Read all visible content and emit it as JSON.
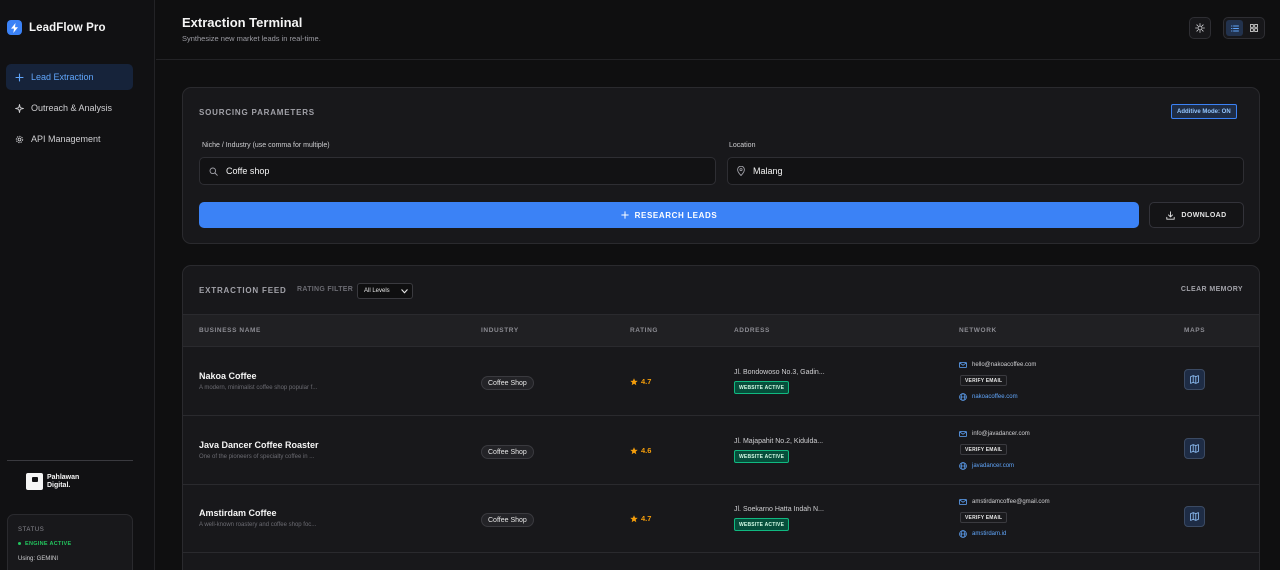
{
  "app": {
    "name": "LeadFlow Pro"
  },
  "sidebar": {
    "items": [
      {
        "label": "Lead Extraction",
        "icon": "plus-icon",
        "active": true
      },
      {
        "label": "Outreach & Analysis",
        "icon": "sparkle-icon",
        "active": false
      },
      {
        "label": "API Management",
        "icon": "gear-icon",
        "active": false
      }
    ],
    "brand_footer": {
      "line1": "Pahlawan",
      "line2": "Digital."
    },
    "status": {
      "title": "STATUS",
      "engine": "ENGINE ACTIVE",
      "using": "Using: GEMINI"
    }
  },
  "header": {
    "title": "Extraction Terminal",
    "subtitle": "Synthesize new market leads in real-time."
  },
  "params": {
    "title": "SOURCING PARAMETERS",
    "mode_badge": "Additive Mode: ON",
    "niche_label": "Niche / Industry (use comma for multiple)",
    "niche_value": "Coffe shop",
    "location_label": "Location",
    "location_value": "Malang",
    "research_button": "RESEARCH LEADS",
    "download_button": "DOWNLOAD"
  },
  "feed": {
    "title": "EXTRACTION FEED",
    "rating_filter_label": "RATING FILTER",
    "rating_filter_value": "All Levels",
    "clear_memory": "CLEAR MEMORY",
    "columns": [
      "BUSINESS NAME",
      "INDUSTRY",
      "RATING",
      "ADDRESS",
      "NETWORK",
      "MAPS"
    ],
    "rows": [
      {
        "name": "Nakoa Coffee",
        "desc": "A modern, minimalist coffee shop popular f...",
        "industry": "Coffee Shop",
        "rating": "4.7",
        "address": "Jl. Bondowoso No.3, Gadin...",
        "web_badge": "WEBSITE ACTIVE",
        "email": "hello@nakoacoffee.com",
        "verify": "VERIFY EMAIL",
        "website": "nakoacoffee.com"
      },
      {
        "name": "Java Dancer Coffee Roaster",
        "desc": "One of the pioneers of specialty coffee in ...",
        "industry": "Coffee Shop",
        "rating": "4.6",
        "address": "Jl. Majapahit No.2, Kidulda...",
        "web_badge": "WEBSITE ACTIVE",
        "email": "info@javadancer.com",
        "verify": "VERIFY EMAIL",
        "website": "javadancer.com"
      },
      {
        "name": "Amstirdam Coffee",
        "desc": "A well-known roastery and coffee shop foc...",
        "industry": "Coffee Shop",
        "rating": "4.7",
        "address": "Jl. Soekarno Hatta Indah N...",
        "web_badge": "WEBSITE ACTIVE",
        "email": "amstirdamcoffee@gmail.com",
        "verify": "VERIFY EMAIL",
        "website": "amstirdam.id"
      }
    ]
  },
  "colors": {
    "accent": "#3b82f6",
    "rating": "#f59e0b",
    "success": "#10b981",
    "background": "#0f0f10",
    "card": "#18181b"
  }
}
